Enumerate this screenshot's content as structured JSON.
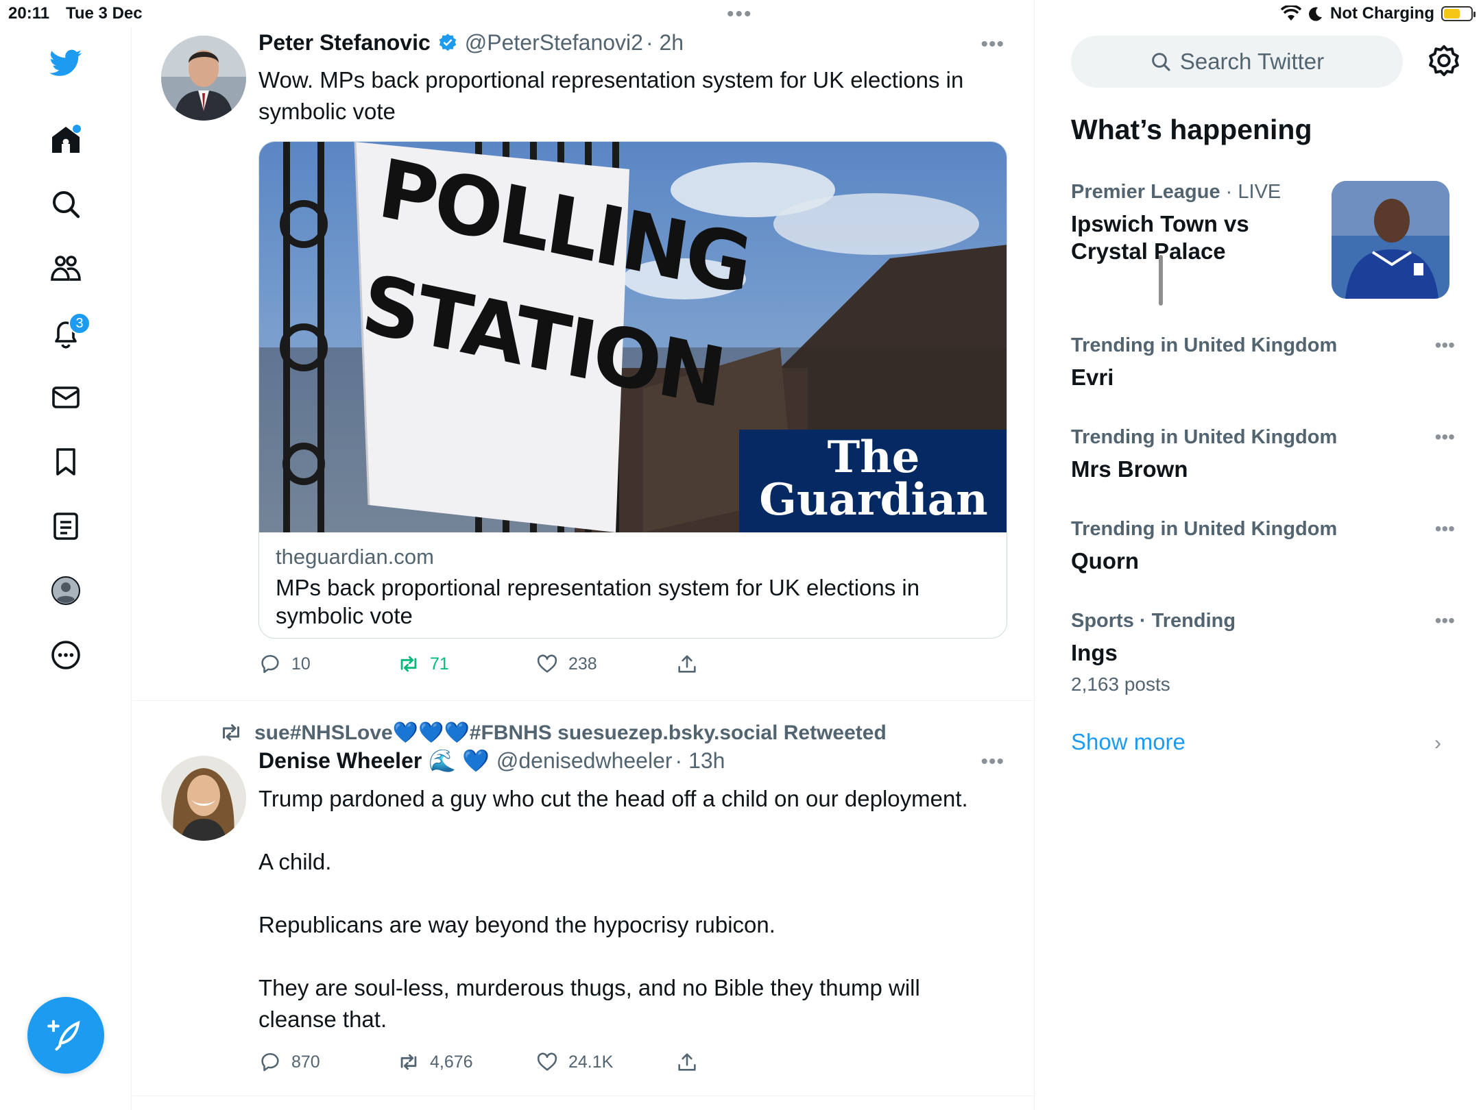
{
  "status_bar": {
    "time": "20:11",
    "date": "Tue 3 Dec",
    "battery_status": "Not Charging",
    "battery_level": 0.6
  },
  "nav": {
    "notifications_badge": "3"
  },
  "tweets": [
    {
      "name": "Peter Stefanovic",
      "handle": "@PeterStefanovi2",
      "time": "· 2h",
      "text": "Wow. MPs back proportional representation system for UK elections in symbolic vote",
      "card": {
        "image_sign_line1": "POLLING",
        "image_sign_line2": "STATION",
        "logo_line1": "The",
        "logo_line2": "Guardian",
        "domain": "theguardian.com",
        "title": "MPs back proportional representation system for UK elections in symbolic vote"
      },
      "replies": "10",
      "retweets": "71",
      "likes": "238"
    },
    {
      "retweeted_by": "sue#NHSLove💙💙💙#FBNHS suesuezep.bsky.social Retweeted",
      "name": "Denise Wheeler",
      "name_emoji": "🌊 💙",
      "handle": "@denisedwheeler",
      "time": "· 13h",
      "paragraphs": [
        "Trump pardoned a guy who cut the head off a child on our deployment.",
        "A child.",
        "Republicans are way beyond the hypocrisy rubicon.",
        "They are soul-less, murderous thugs, and no Bible they thump will cleanse that."
      ],
      "replies": "870",
      "retweets": "4,676",
      "likes": "24.1K"
    }
  ],
  "sidebar": {
    "search_placeholder": "Search Twitter",
    "title": "What’s happening",
    "trends": [
      {
        "meta": "Premier League",
        "meta_suffix": " · LIVE",
        "name": "Ipswich Town vs Crystal Palace",
        "count": ""
      },
      {
        "meta": "Trending in United Kingdom",
        "meta_suffix": "",
        "name": "Evri",
        "count": ""
      },
      {
        "meta": "Trending in United Kingdom",
        "meta_suffix": "",
        "name": "Mrs Brown",
        "count": ""
      },
      {
        "meta": "Trending in United Kingdom",
        "meta_suffix": "",
        "name": "Quorn",
        "count": ""
      },
      {
        "meta": "Sports · Trending",
        "meta_suffix": "",
        "name": "Ings",
        "count": "2,163 posts"
      }
    ],
    "show_more": "Show more"
  },
  "colors": {
    "accent": "#1d9bf0",
    "retweet_green": "#00ba7c",
    "secondary_text": "#536471",
    "guardian_blue": "#052962"
  }
}
